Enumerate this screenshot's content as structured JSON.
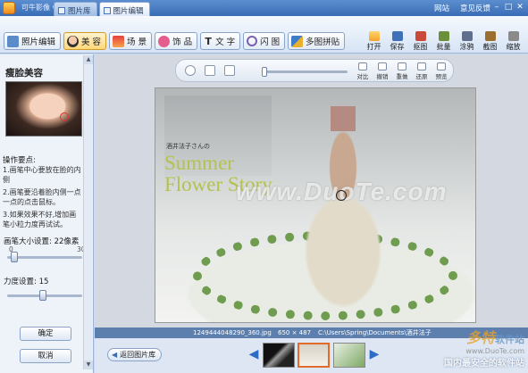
{
  "window": {
    "app_title": "可牛影像 v1.9.3.1001",
    "tabs": [
      {
        "label": "图片库"
      },
      {
        "label": "图片编辑"
      }
    ],
    "top_links": [
      "网站",
      "意见反馈"
    ],
    "controls": [
      "minimize",
      "maximize",
      "close"
    ]
  },
  "toolbar": {
    "tabs": [
      {
        "label": "照片编辑",
        "icon": "photo-icon"
      },
      {
        "label": "美 容",
        "icon": "face-icon",
        "active": true
      },
      {
        "label": "场 景",
        "icon": "scene-icon"
      },
      {
        "label": "饰 品",
        "icon": "ornament-icon"
      },
      {
        "label": "文 字",
        "icon": "text-icon"
      },
      {
        "label": "闪 图",
        "icon": "frame-icon"
      },
      {
        "label": "多图拼贴",
        "icon": "collage-icon"
      }
    ],
    "actions": [
      {
        "label": "打开",
        "icon": "open-icon"
      },
      {
        "label": "保存",
        "icon": "save-icon"
      },
      {
        "label": "抠图",
        "icon": "cutout-icon"
      },
      {
        "label": "批量",
        "icon": "batch-icon"
      },
      {
        "label": "涂鸦",
        "icon": "doodle-icon"
      },
      {
        "label": "截图",
        "icon": "screenshot-icon"
      },
      {
        "label": "缩放",
        "icon": "zoom-icon"
      }
    ]
  },
  "left_panel": {
    "title": "瘦脸美容",
    "tips_header": "操作要点:",
    "tips": [
      "1.画笔中心要放在脸的内侧",
      "2.画笔要沿着脸内侧一点一点的点击鼠标。",
      "3.如果效果不好,增加画笔小粒力度再试试。"
    ],
    "brush_size_label": "画笔大小设置: 22像素",
    "brush_size": {
      "min": "0",
      "max": "30",
      "value": 22
    },
    "strength_label": "力度设置: 15",
    "strength": {
      "value": 15
    },
    "ok_button": "确定",
    "cancel_button": "取消"
  },
  "canvas": {
    "tool_labels": [
      "对比",
      "撤销",
      "重做",
      "还原",
      "预览"
    ],
    "photo_subtitle": "酒井法子さんの",
    "photo_title_line1": "Summer",
    "photo_title_line2": "Flower Story",
    "watermark": "www.DuoTe.com"
  },
  "status_bar": {
    "filename": "1249444048290_360.jpg",
    "dimensions": "650 × 487",
    "path": "C:\\Users\\Spring\\Documents\\酒井法子"
  },
  "filmstrip": {
    "back_button": "返回图片库",
    "watermark_brand": "多特",
    "watermark_brand_suffix": "软件站",
    "watermark_url": "www.DuoTe.com",
    "watermark_slogan": "国内最安全的软件站"
  },
  "colors": {
    "title_bar": "#3a6db4",
    "active_tab": "#ffd87a",
    "photo_title": "#b4c24f",
    "status_bar": "#5d7fae"
  }
}
